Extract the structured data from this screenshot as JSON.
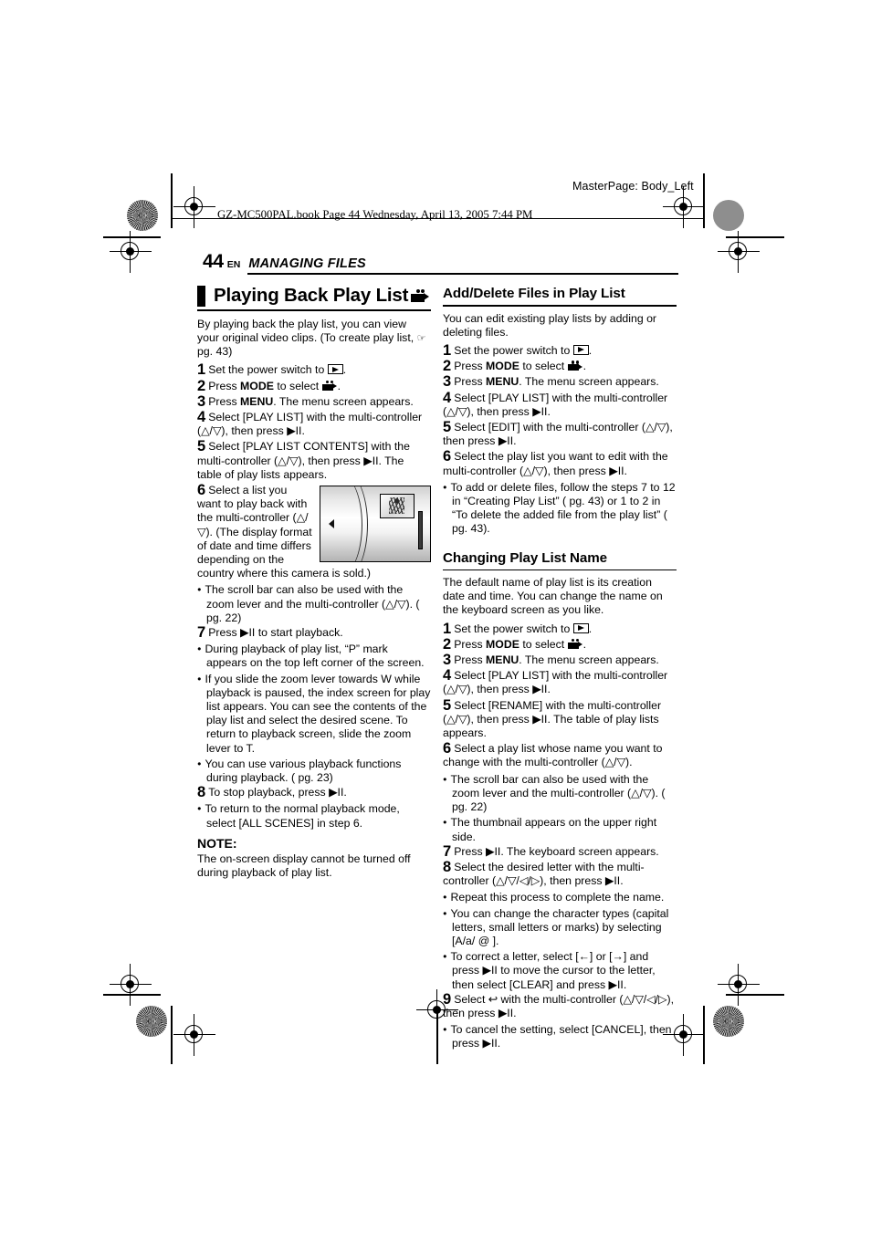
{
  "printmarks": {
    "masterpage": "MasterPage: Body_Left",
    "bookline": "GZ-MC500PAL.book  Page 44  Wednesday, April 13, 2005  7:44 PM"
  },
  "runninghead": {
    "page_number": "44",
    "language": "EN",
    "section": "MANAGING FILES"
  },
  "left_column": {
    "title": "Playing Back Play List",
    "title_icon": "camcorder-icon",
    "intro": "By playing back the play list, you can view your original video clips. (To create play list,",
    "intro_ref": "pg. 43)",
    "steps": [
      {
        "num": "1",
        "pre": "Set the power switch to ",
        "icon": "play-icon",
        "post": "."
      },
      {
        "num": "2",
        "pre": "Press ",
        "bold": "MODE",
        "mid": " to select ",
        "icon": "camcorder-icon",
        "post": "."
      },
      {
        "num": "3",
        "pre": "Press ",
        "bold": "MENU",
        "post": ". The menu screen appears."
      },
      {
        "num": "4",
        "text": "Select [PLAY LIST] with the multi-controller (△/▽), then press ▶II."
      },
      {
        "num": "5",
        "text": "Select [PLAY LIST CONTENTS] with the multi-controller (△/▽), then press ▶II. The table of play lists appears."
      },
      {
        "num": "6",
        "text": "Select a list you want to play back with the multi-controller (△/▽). (The display format of date and time differs depending on the country where this camera is sold.)"
      },
      {
        "num": "7",
        "text": "Press ▶II to start playback."
      },
      {
        "num": "8",
        "text": "To stop playback, press ▶II."
      }
    ],
    "bullets": {
      "after6": "The scroll bar can also be used with the zoom lever and the multi-controller (△/▽). ( pg. 22)",
      "after7_a": "During playback of play list, “P” mark appears on the top left corner of the screen.",
      "after7_b": "If you slide the zoom lever towards W while playback is paused, the index screen for play list appears. You can see the contents of the play list and select the desired scene. To return to playback screen, slide the zoom lever to T.",
      "after7_c": "You can use various playback functions during playback. ( pg. 23)",
      "after8": "To return to the normal playback mode, select [ALL SCENES] in step 6."
    },
    "note_label": "NOTE:",
    "note_text": "The on-screen display cannot be turned off during playback of play list.",
    "illustration": "camera-lcd-play-list-screen"
  },
  "right_column": {
    "section1": {
      "title": "Add/Delete Files in Play List",
      "intro": "You can edit existing play lists by adding or deleting files.",
      "steps": [
        {
          "num": "1",
          "pre": "Set the power switch to ",
          "icon": "play-icon",
          "post": "."
        },
        {
          "num": "2",
          "pre": "Press ",
          "bold": "MODE",
          "mid": " to select ",
          "icon": "camcorder-icon",
          "post": "."
        },
        {
          "num": "3",
          "pre": "Press ",
          "bold": "MENU",
          "post": ". The menu screen appears."
        },
        {
          "num": "4",
          "text": "Select [PLAY LIST] with the multi-controller (△/▽), then press ▶II."
        },
        {
          "num": "5",
          "text": "Select [EDIT] with the multi-controller (△/▽), then press ▶II."
        },
        {
          "num": "6",
          "text": "Select the play list you want to edit with the multi-controller (△/▽), then press ▶II."
        }
      ],
      "bullet": "To add or delete files, follow the steps 7 to 12 in “Creating Play List” ( pg. 43) or 1 to 2 in “To delete the added file from the play list” ( pg. 43)."
    },
    "section2": {
      "title": "Changing Play List Name",
      "intro": "The default name of play list is its creation date and time. You can change the name on the keyboard screen as you like.",
      "steps": [
        {
          "num": "1",
          "pre": "Set the power switch to ",
          "icon": "play-icon",
          "post": "."
        },
        {
          "num": "2",
          "pre": "Press ",
          "bold": "MODE",
          "mid": " to select ",
          "icon": "camcorder-icon",
          "post": "."
        },
        {
          "num": "3",
          "pre": "Press ",
          "bold": "MENU",
          "post": ". The menu screen appears."
        },
        {
          "num": "4",
          "text": "Select [PLAY LIST] with the multi-controller (△/▽), then press ▶II."
        },
        {
          "num": "5",
          "text": "Select [RENAME] with the multi-controller (△/▽), then press ▶II. The table of play lists appears."
        },
        {
          "num": "6",
          "text": "Select a play list whose name you want to change with the multi-controller (△/▽)."
        },
        {
          "num": "7",
          "text": "Press ▶II. The keyboard screen appears."
        },
        {
          "num": "8",
          "text": "Select the desired letter with the multi-controller (△/▽/◁/▷), then press ▶II."
        },
        {
          "num": "9",
          "text": "Select ↩ with the multi-controller (△/▽/◁/▷), then press ▶II."
        }
      ],
      "bullets": {
        "after6_a": "The scroll bar can also be used with the zoom lever and the multi-controller (△/▽). ( pg. 22)",
        "after6_b": "The thumbnail appears on the upper right side.",
        "after8_a": "Repeat this process to complete the name.",
        "after8_b": "You can change the character types (capital letters, small letters or marks) by selecting [A/a/ @ ].",
        "after8_c": "To correct a letter, select [←] or [→] and press ▶II to move the cursor to the letter, then select [CLEAR] and press ▶II.",
        "after9": "To cancel the setting, select [CANCEL], then press ▶II."
      }
    }
  }
}
